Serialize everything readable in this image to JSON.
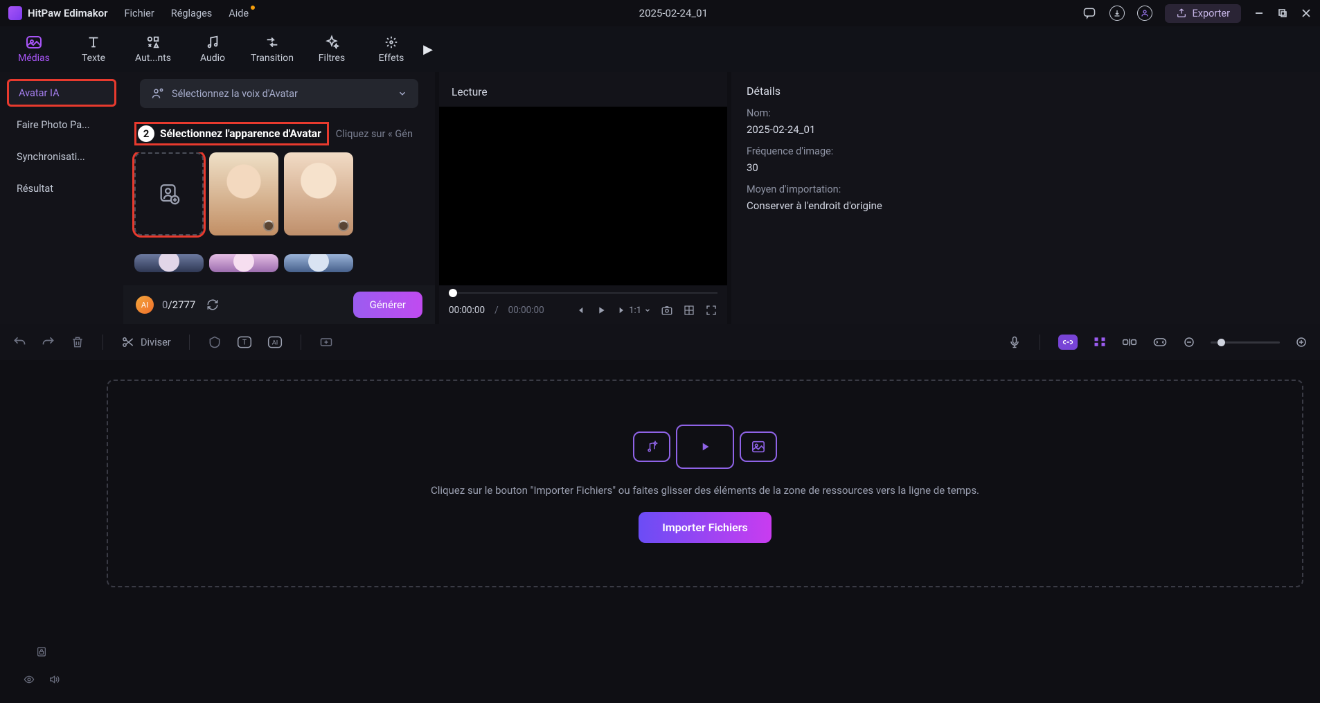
{
  "app": {
    "name": "HitPaw Edimakor",
    "project_title": "2025-02-24_01"
  },
  "menus": {
    "file": "Fichier",
    "settings": "Réglages",
    "help": "Aide"
  },
  "header_actions": {
    "export": "Exporter"
  },
  "tabs": {
    "media": "Médias",
    "text": "Texte",
    "autres": "Aut...nts",
    "audio": "Audio",
    "transition": "Transition",
    "filters": "Filtres",
    "effects": "Effets"
  },
  "sidebar": {
    "avatar": "Avatar IA",
    "photo": "Faire Photo Pa...",
    "sync": "Synchronisati...",
    "result": "Résultat"
  },
  "voice_select": "Sélectionnez la voix d'Avatar",
  "step2": {
    "num": "2",
    "text": "Sélectionnez l'apparence d'Avatar"
  },
  "step_hint": "Cliquez sur « Gén",
  "credits": {
    "used": "0",
    "total": "2777"
  },
  "generate": "Générer",
  "preview": {
    "title": "Lecture",
    "time_current": "00:00:00",
    "time_total": "00:00:00",
    "speed": "1:1"
  },
  "details": {
    "title": "Détails",
    "name_label": "Nom:",
    "name_value": "2025-02-24_01",
    "fps_label": "Fréquence d'image:",
    "fps_value": "30",
    "import_label": "Moyen d'importation:",
    "import_value": "Conserver à l'endroit d'origine"
  },
  "toolbar": {
    "split": "Diviser"
  },
  "timeline": {
    "drop_text": "Cliquez sur le bouton \"Importer Fichiers\" ou faites glisser des éléments de la zone de ressources vers la ligne de temps.",
    "import_btn": "Importer Fichiers"
  }
}
